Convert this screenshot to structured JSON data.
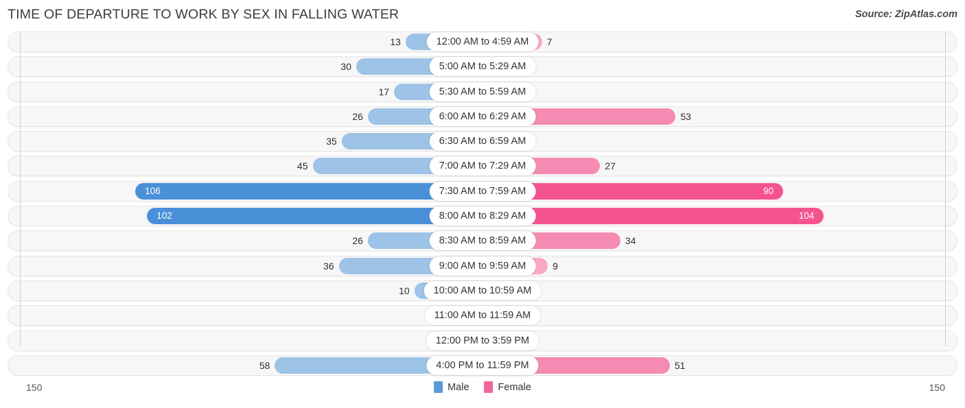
{
  "header": {
    "title": "TIME OF DEPARTURE TO WORK BY SEX IN FALLING WATER",
    "source": "Source: ZipAtlas.com"
  },
  "legend": {
    "items": [
      {
        "label": "Male",
        "color": "#5B9BD5"
      },
      {
        "label": "Female",
        "color": "#F0659A"
      }
    ]
  },
  "axis": {
    "left_max": "150",
    "right_max": "150"
  },
  "colors": {
    "male_light": "#9DC3E6",
    "male_dark": "#4A90D9",
    "female_light": "#F9A8C4",
    "female_mid": "#F58BB2",
    "female_dark": "#F4538F",
    "track_bg": "#f7f7f7",
    "track_border": "#e6e6e6"
  },
  "chart_data": {
    "type": "bar",
    "subtype": "diverging-bidirectional",
    "title": "TIME OF DEPARTURE TO WORK BY SEX IN FALLING WATER",
    "xlabel": "",
    "ylabel": "",
    "xlim": [
      150,
      150
    ],
    "grid": false,
    "legend_position": "bottom-center",
    "categories": [
      "12:00 AM to 4:59 AM",
      "5:00 AM to 5:29 AM",
      "5:30 AM to 5:59 AM",
      "6:00 AM to 6:29 AM",
      "6:30 AM to 6:59 AM",
      "7:00 AM to 7:29 AM",
      "7:30 AM to 7:59 AM",
      "8:00 AM to 8:29 AM",
      "8:30 AM to 8:59 AM",
      "9:00 AM to 9:59 AM",
      "10:00 AM to 10:59 AM",
      "11:00 AM to 11:59 AM",
      "12:00 PM to 3:59 PM",
      "4:00 PM to 11:59 PM"
    ],
    "series": [
      {
        "name": "Male",
        "direction": "left",
        "values": [
          13,
          30,
          17,
          26,
          35,
          45,
          106,
          102,
          26,
          36,
          10,
          0,
          0,
          58
        ]
      },
      {
        "name": "Female",
        "direction": "right",
        "values": [
          7,
          0,
          0,
          53,
          0,
          27,
          90,
          104,
          34,
          9,
          0,
          0,
          0,
          51
        ]
      }
    ]
  },
  "rows": [
    {
      "category": "12:00 AM to 4:59 AM",
      "male": "13",
      "female": "7"
    },
    {
      "category": "5:00 AM to 5:29 AM",
      "male": "30",
      "female": "0"
    },
    {
      "category": "5:30 AM to 5:59 AM",
      "male": "17",
      "female": "0"
    },
    {
      "category": "6:00 AM to 6:29 AM",
      "male": "26",
      "female": "53"
    },
    {
      "category": "6:30 AM to 6:59 AM",
      "male": "35",
      "female": "0"
    },
    {
      "category": "7:00 AM to 7:29 AM",
      "male": "45",
      "female": "27"
    },
    {
      "category": "7:30 AM to 7:59 AM",
      "male": "106",
      "female": "90"
    },
    {
      "category": "8:00 AM to 8:29 AM",
      "male": "102",
      "female": "104"
    },
    {
      "category": "8:30 AM to 8:59 AM",
      "male": "26",
      "female": "34"
    },
    {
      "category": "9:00 AM to 9:59 AM",
      "male": "36",
      "female": "9"
    },
    {
      "category": "10:00 AM to 10:59 AM",
      "male": "10",
      "female": "0"
    },
    {
      "category": "11:00 AM to 11:59 AM",
      "male": "0",
      "female": "0"
    },
    {
      "category": "12:00 PM to 3:59 PM",
      "male": "0",
      "female": "0"
    },
    {
      "category": "4:00 PM to 11:59 PM",
      "male": "58",
      "female": "51"
    }
  ]
}
